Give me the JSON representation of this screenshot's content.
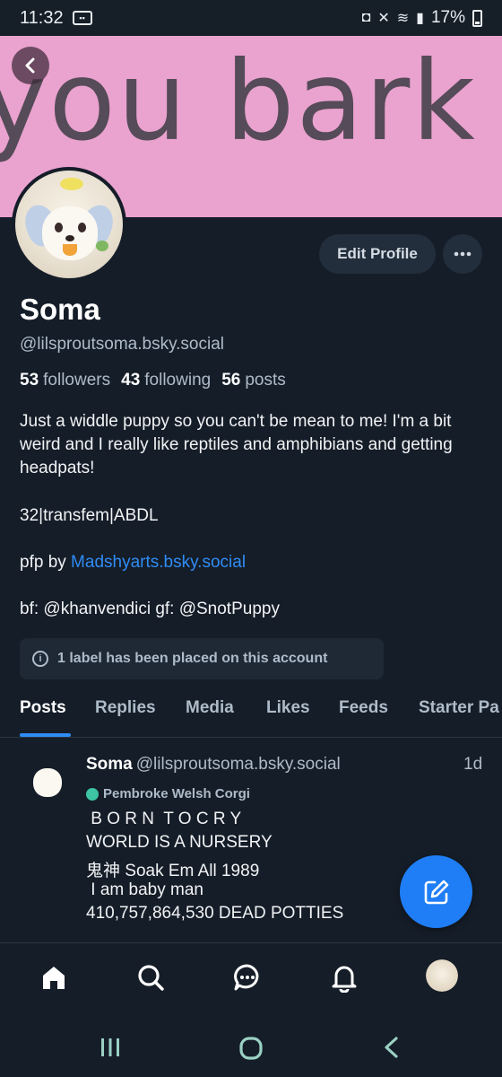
{
  "status_bar": {
    "time": "11:32",
    "battery": "17%"
  },
  "banner": {
    "text": "you bark",
    "bg_color": "#eaa2cf"
  },
  "profile": {
    "edit_label": "Edit Profile",
    "display_name": "Soma",
    "handle": "@lilsproutsoma.bsky.social",
    "followers_count": "53",
    "followers_label": "followers",
    "following_count": "43",
    "following_label": "following",
    "posts_count": "56",
    "posts_label": "posts",
    "bio_line_1": "Just a widdle puppy so you can't be mean to me! I'm a bit weird and I really like reptiles and amphibians and getting headpats!",
    "bio_line_2": "32|transfem|ABDL",
    "bio_pfp_prefix": "pfp by ",
    "bio_pfp_link": "Madshyarts.bsky.social",
    "bio_line_4": "bf: @khanvendici gf: @SnotPuppy",
    "label_notice": "1 label has been placed on this account"
  },
  "tabs": [
    "Posts",
    "Replies",
    "Media",
    "Likes",
    "Feeds",
    "Starter Pa"
  ],
  "post": {
    "author": "Soma",
    "handle": "@lilsproutsoma.bsky.social",
    "time": "1d",
    "badge": "Pembroke Welsh Corgi",
    "lines": [
      " B O R N  T O C R Y",
      "WORLD IS A NURSERY",
      "鬼神 Soak Em All 1989",
      " I am baby man",
      "410,757,864,530 DEAD POTTIES"
    ]
  },
  "colors": {
    "background": "#151d28",
    "accent": "#2f8cf4",
    "fab": "#1f7ef6"
  },
  "bottom_nav": [
    "home-icon",
    "search-icon",
    "chat-icon",
    "bell-icon",
    "avatar"
  ],
  "system_nav": [
    "recents-icon",
    "home-circle-icon",
    "back-chevron-icon"
  ]
}
